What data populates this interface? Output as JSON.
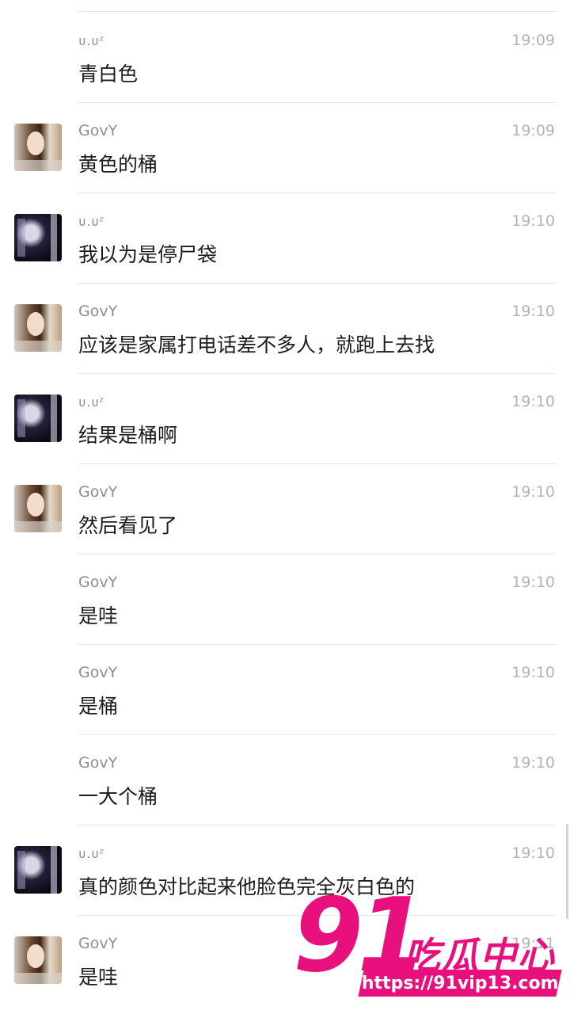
{
  "messages": [
    {
      "sender": "ᴜ.ᴜᶻ",
      "time": "19:09",
      "text": "青白色",
      "avatar": "none"
    },
    {
      "sender": "GovY",
      "time": "19:09",
      "text": "黄色的桶",
      "avatar": "govy"
    },
    {
      "sender": "ᴜ.ᴜᶻ",
      "time": "19:10",
      "text": "我以为是停尸袋",
      "avatar": "uoz"
    },
    {
      "sender": "GovY",
      "time": "19:10",
      "text": "应该是家属打电话差不多人，就跑上去找",
      "avatar": "govy"
    },
    {
      "sender": "ᴜ.ᴜᶻ",
      "time": "19:10",
      "text": "结果是桶啊",
      "avatar": "uoz"
    },
    {
      "sender": "GovY",
      "time": "19:10",
      "text": "然后看见了",
      "avatar": "govy"
    },
    {
      "sender": "GovY",
      "time": "19:10",
      "text": "是哇",
      "avatar": "none"
    },
    {
      "sender": "GovY",
      "time": "19:10",
      "text": "是桶",
      "avatar": "none"
    },
    {
      "sender": "GovY",
      "time": "19:10",
      "text": "一大个桶",
      "avatar": "none"
    },
    {
      "sender": "ᴜ.ᴜᶻ",
      "time": "19:10",
      "text": "真的颜色对比起来他脸色完全灰白色的",
      "avatar": "uoz"
    },
    {
      "sender": "GovY",
      "time": "19:11",
      "text": "是哇",
      "avatar": "govy"
    }
  ],
  "watermark": {
    "number": "91",
    "chinese": "吃瓜中心",
    "url": "https://91vip13.com",
    "color": "#e8107c"
  }
}
